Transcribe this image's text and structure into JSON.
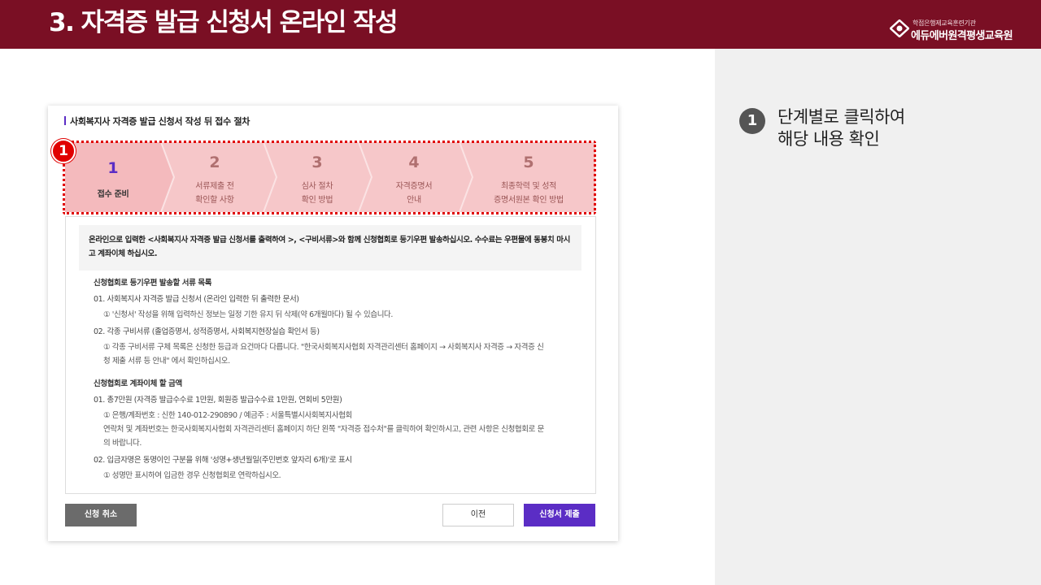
{
  "header": {
    "title": "3. 자격증 발급 신청서 온라인 작성",
    "brand_sub": "학점은행제교육훈련기관",
    "brand_name": "에듀에버원격평생교육원",
    "bg_color": "#7a0f24"
  },
  "guide": {
    "badge": "1",
    "line1": "단계별로 클릭하여",
    "line2": "해당 내용 확인"
  },
  "card": {
    "title": "사회복지사 자격증 발급 신청서 작성 뒤 접수 절차",
    "highlight_marker": "1",
    "steps": [
      {
        "num": "1",
        "line1": "접수 준비",
        "line2": "",
        "active": true
      },
      {
        "num": "2",
        "line1": "서류제출 전",
        "line2": "확인할 사항",
        "active": false
      },
      {
        "num": "3",
        "line1": "심사 절차",
        "line2": "확인 방법",
        "active": false
      },
      {
        "num": "4",
        "line1": "자격증명서",
        "line2": "안내",
        "active": false
      },
      {
        "num": "5",
        "line1": "최종학력 및 성적",
        "line2": "증명서원본 확인 방법",
        "active": false
      }
    ],
    "notice_line1": "온라인으로 입력한 <사회복지사 자격증 발급 신청서를 출력하여 >, <구비서류>와 함께 신청협회로 등기우편 발송하십시오. 수수료는 우편물에 동봉치 마시",
    "notice_line2": "고 계좌이체 하십시오.",
    "section1_title": "신청협회로 등기우편 발송할 서류 목록",
    "item1": "01. 사회복지사 자격증 발급 신청서 (온라인 입력한 뒤 출력한 문서)",
    "item1_note": "① '신청서' 작성을 위해 입력하신 정보는 일정 기한 유지 뒤 삭제(약 6개월마다) 될 수 있습니다.",
    "item2": "02. 각종 구비서류 (졸업증명서, 성적증명서, 사회복지현장실습 확인서 등)",
    "item2_note1": "① 각종 구비서류 구체 목록은 신청한 등급과 요건마다 다릅니다. \"한국사회복지사협회 자격관리센터 홈페이지 → 사회복지사 자격증 → 자격증 신",
    "item2_note2": "청 제출 서류 등 안내\" 에서 확인하십시오.",
    "section2_title": "신청협회로 계좌이체 할 금액",
    "item3": "01. 총7만원 (자격증 발급수수료 1만원, 회원증 발급수수료 1만원, 연회비 5만원)",
    "item3_note1": "① 은행/계좌번호 : 신한 140-012-290890 / 예금주 : 서울특별시사회복지사협회",
    "item3_note2": "연락처 및 계좌번호는 한국사회복지사협회 자격관리센터 홈페이지 하단 왼쪽 \"자격증 접수처\"를 클릭하여 확인하시고, 관련 사항은 신청협회로 문",
    "item3_note3": "의 바랍니다.",
    "item4": "02. 입금자명은 동명이인 구분을 위해 '성명+생년월일(주민번호 앞자리 6개)'로 표시",
    "item4_note": "① 성명만 표시하여 입금한 경우 신청협회로 연락하십시오.",
    "btn_cancel": "신청 취소",
    "btn_prev": "이전",
    "btn_submit": "신청서 제출",
    "accent_color": "#5b2dc5",
    "highlight_color": "#e00000"
  }
}
